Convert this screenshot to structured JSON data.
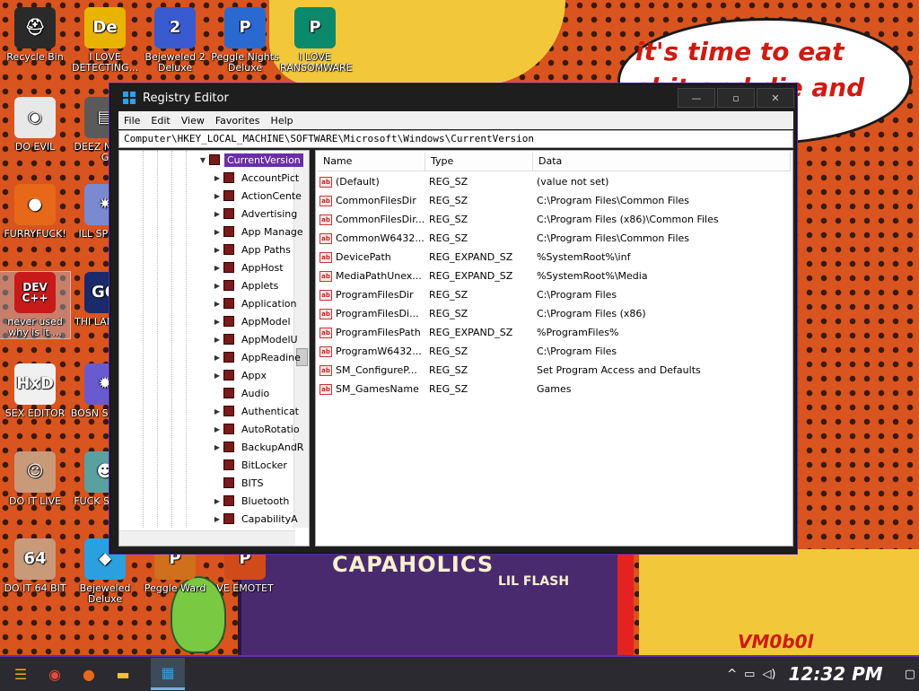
{
  "wallpaper": {
    "bubble_text": "it's time to eat shit and die and chew",
    "poster_title": "CAPAHOLICS",
    "poster_sub": "LIL FLASH",
    "corner_text": "VM0b0l"
  },
  "desktop_icons": [
    {
      "label": "Recycle Bin",
      "icon": "recycle-bin-icon",
      "glyph": "⛑",
      "color": "#2a2a2a"
    },
    {
      "label": "I LOVE DETECTING...",
      "icon": "detect-it-easy-icon",
      "glyph": "De",
      "color": "#e8b400"
    },
    {
      "label": "Bejeweled 2 Deluxe",
      "icon": "bejeweled-2-icon",
      "glyph": "2",
      "color": "#3a5ad0"
    },
    {
      "label": "Peggle Nights Deluxe",
      "icon": "peggle-nights-icon",
      "glyph": "P",
      "color": "#2a6ad0"
    },
    {
      "label": "I LOVE RANSOMWARE",
      "icon": "publisher-icon",
      "glyph": "P",
      "color": "#0a8a6a"
    },
    {
      "label": "DO EVIL",
      "icon": "chrome-icon",
      "glyph": "◉",
      "color": "#e8e8e8"
    },
    {
      "label": "DEEZ N HAH G",
      "icon": "files-icon",
      "glyph": "▤",
      "color": "#5a5a5a"
    },
    {
      "label": "FURRYFUCK!",
      "icon": "firefox-icon",
      "glyph": "●",
      "color": "#e8681a"
    },
    {
      "label": "ILL SP YOU",
      "icon": "spy-icon",
      "glyph": "✷",
      "color": "#7a8ad0"
    },
    {
      "label": "never used why is it ...",
      "icon": "dev-cpp-icon",
      "glyph": "DEV C++",
      "color": "#c81a1a"
    },
    {
      "label": "THI LANGUA",
      "icon": "go-icon",
      "glyph": "GO",
      "color": "#1a2a6a"
    },
    {
      "label": "SEX EDITOR",
      "icon": "hxd-icon",
      "glyph": "HxD",
      "color": "#f0f0f0"
    },
    {
      "label": "BOSN SIMULA",
      "icon": "bosnian-sim-icon",
      "glyph": "✹",
      "color": "#6a5ad0"
    },
    {
      "label": "DO IT LIVE",
      "icon": "portrait-icon",
      "glyph": "☺",
      "color": "#c89a7a"
    },
    {
      "label": "FUCK S ELVE",
      "icon": "elves-icon",
      "glyph": "☻",
      "color": "#5aa0a0"
    },
    {
      "label": "DO IT 64 BIT",
      "icon": "portrait-64-icon",
      "glyph": "64",
      "color": "#c89a7a"
    },
    {
      "label": "Bejeweled Deluxe",
      "icon": "bejeweled-icon",
      "glyph": "◆",
      "color": "#2aa0e0"
    },
    {
      "label": "Peggle Ward",
      "icon": "peggle-icon",
      "glyph": "P",
      "color": "#d0701a"
    },
    {
      "label": "VE EMOTET",
      "icon": "powerpoint-icon",
      "glyph": "P",
      "color": "#d04a1a"
    }
  ],
  "window": {
    "title": "Registry Editor",
    "menu": [
      "File",
      "Edit",
      "View",
      "Favorites",
      "Help"
    ],
    "address": "Computer\\HKEY_LOCAL_MACHINE\\SOFTWARE\\Microsoft\\Windows\\CurrentVersion",
    "tree": [
      {
        "label": "CurrentVersion",
        "expanded": true,
        "selected": true
      },
      {
        "label": "AccountPict"
      },
      {
        "label": "ActionCente"
      },
      {
        "label": "Advertising"
      },
      {
        "label": "App Manage"
      },
      {
        "label": "App Paths"
      },
      {
        "label": "AppHost"
      },
      {
        "label": "Applets"
      },
      {
        "label": "Application"
      },
      {
        "label": "AppModel"
      },
      {
        "label": "AppModelU"
      },
      {
        "label": "AppReadine"
      },
      {
        "label": "Appx"
      },
      {
        "label": "Audio",
        "leaf": true
      },
      {
        "label": "Authenticat"
      },
      {
        "label": "AutoRotatio"
      },
      {
        "label": "BackupAndR"
      },
      {
        "label": "BitLocker",
        "leaf": true
      },
      {
        "label": "BITS",
        "leaf": true
      },
      {
        "label": "Bluetooth"
      },
      {
        "label": "CapabilityA"
      }
    ],
    "columns": [
      "Name",
      "Type",
      "Data"
    ],
    "values": [
      {
        "name": "(Default)",
        "type": "REG_SZ",
        "data": "(value not set)"
      },
      {
        "name": "CommonFilesDir",
        "type": "REG_SZ",
        "data": "C:\\Program Files\\Common Files"
      },
      {
        "name": "CommonFilesDir...",
        "type": "REG_SZ",
        "data": "C:\\Program Files (x86)\\Common Files"
      },
      {
        "name": "CommonW6432...",
        "type": "REG_SZ",
        "data": "C:\\Program Files\\Common Files"
      },
      {
        "name": "DevicePath",
        "type": "REG_EXPAND_SZ",
        "data": "%SystemRoot%\\inf"
      },
      {
        "name": "MediaPathUnex...",
        "type": "REG_EXPAND_SZ",
        "data": "%SystemRoot%\\Media"
      },
      {
        "name": "ProgramFilesDir",
        "type": "REG_SZ",
        "data": "C:\\Program Files"
      },
      {
        "name": "ProgramFilesDi...",
        "type": "REG_SZ",
        "data": "C:\\Program Files (x86)"
      },
      {
        "name": "ProgramFilesPath",
        "type": "REG_EXPAND_SZ",
        "data": "%ProgramFiles%"
      },
      {
        "name": "ProgramW6432...",
        "type": "REG_SZ",
        "data": "C:\\Program Files"
      },
      {
        "name": "SM_ConfigureP...",
        "type": "REG_SZ",
        "data": "Set Program Access and Defaults"
      },
      {
        "name": "SM_GamesName",
        "type": "REG_SZ",
        "data": "Games"
      }
    ]
  },
  "taskbar": {
    "items": [
      {
        "icon": "start-icon",
        "glyph": "☰",
        "color": "#e8a01a"
      },
      {
        "icon": "chrome-taskbar-icon",
        "glyph": "◉",
        "color": "#e84a3a"
      },
      {
        "icon": "firefox-taskbar-icon",
        "glyph": "●",
        "color": "#e8681a"
      },
      {
        "icon": "file-explorer-icon",
        "glyph": "▬",
        "color": "#f0c040"
      },
      {
        "icon": "registry-editor-taskbar-icon",
        "glyph": "▦",
        "color": "#2ea0e8",
        "active": true
      }
    ],
    "clock": "12:32 PM"
  }
}
